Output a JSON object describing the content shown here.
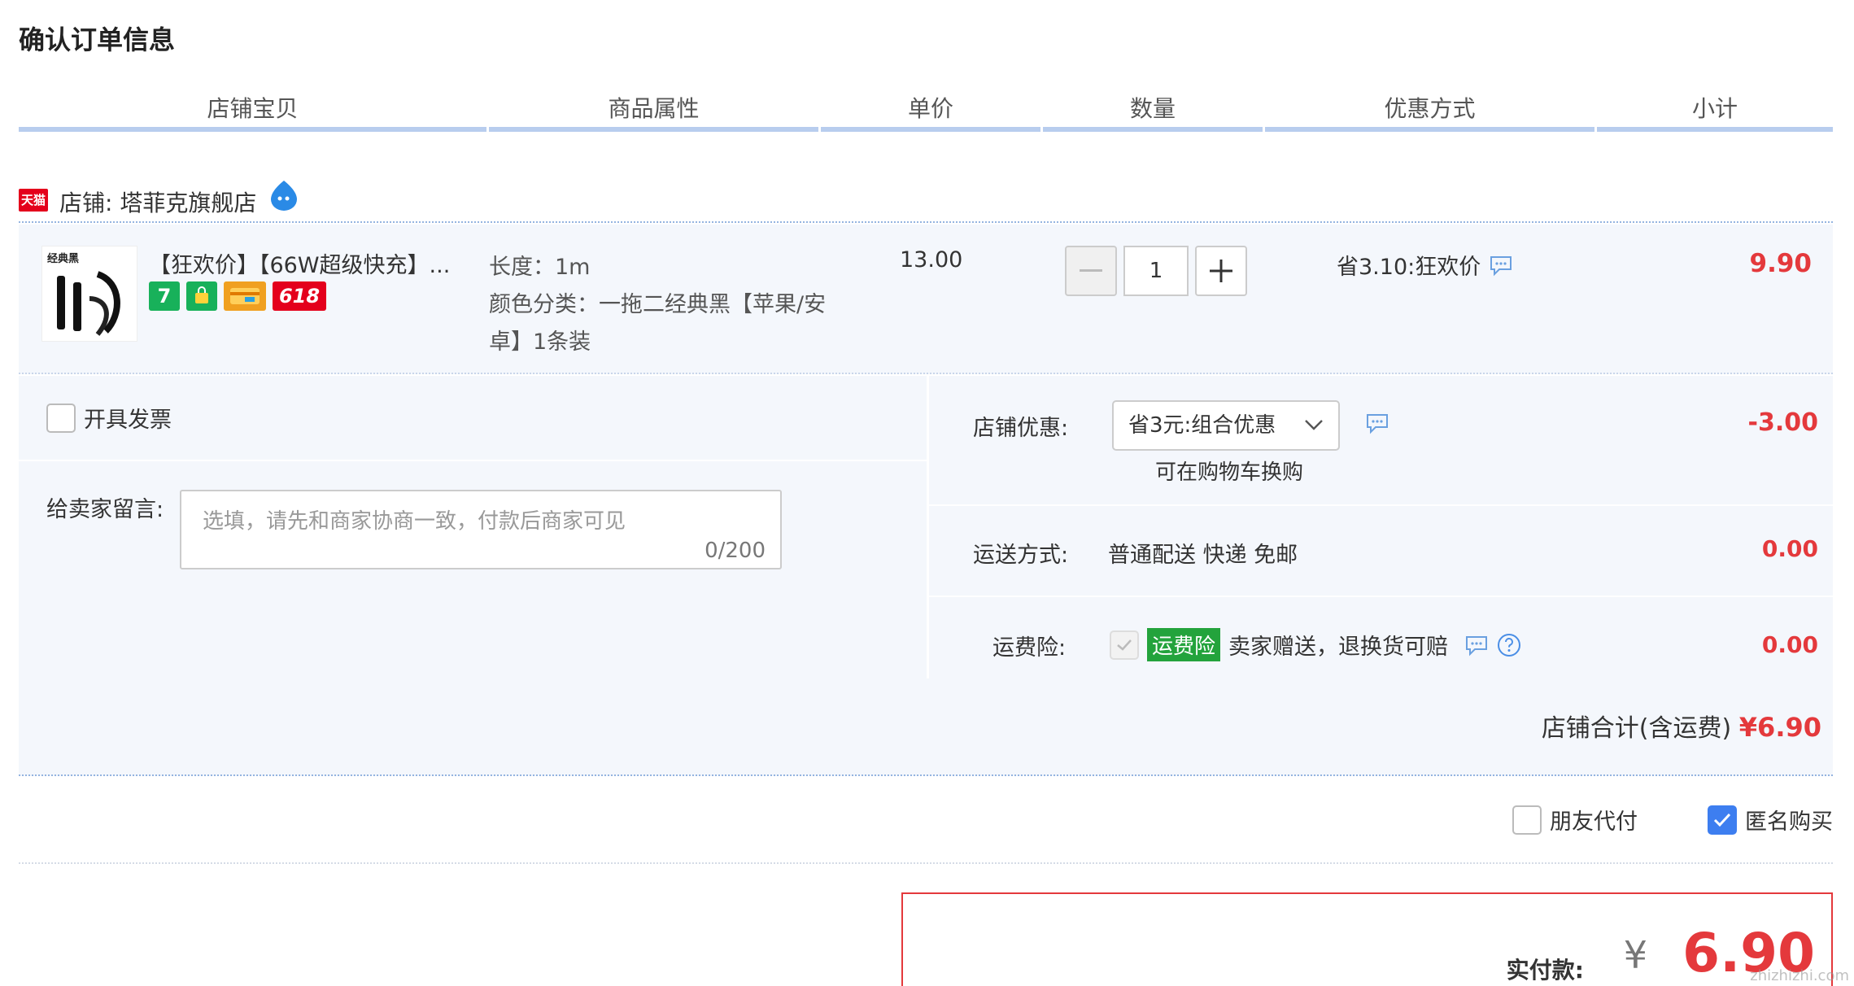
{
  "page": {
    "title": "确认订单信息"
  },
  "columns": [
    "店铺宝贝",
    "商品属性",
    "单价",
    "数量",
    "优惠方式",
    "小计"
  ],
  "shop": {
    "badge": "天猫",
    "label": "店铺: 塔菲克旗舰店"
  },
  "item": {
    "thumb_caption": "经典黑",
    "title": "【狂欢价】【66W超级快充】...",
    "badges": [
      "7",
      "618"
    ],
    "props": [
      "长度：1m",
      "颜色分类：一拖二经典黑【苹果/安卓】1条装"
    ],
    "unit_price": "13.00",
    "quantity": "1",
    "promo": "省3.10:狂欢价",
    "subtotal": "9.90"
  },
  "invoice": {
    "label": "开具发票"
  },
  "memo": {
    "label": "给卖家留言:",
    "placeholder": "选填，请先和商家协商一致，付款后商家可见",
    "counter": "0/200"
  },
  "shop_discount": {
    "label": "店铺优惠:",
    "selected": "省3元:组合优惠",
    "hint": "可在购物车换购",
    "amount": "-3.00"
  },
  "shipping": {
    "label": "运送方式:",
    "value": "普通配送 快递 免邮",
    "amount": "0.00"
  },
  "insurance": {
    "label": "运费险:",
    "badge": "运费险",
    "text": "卖家赠送，退换货可赔",
    "amount": "0.00"
  },
  "shop_total": {
    "label": "店铺合计(含运费)",
    "amount": "¥6.90"
  },
  "options": {
    "friend_pay": "朋友代付",
    "anonymous": "匿名购买"
  },
  "payment": {
    "label": "实付款:",
    "currency": "¥",
    "amount": "6.90"
  },
  "watermark": "zhizhizhi.com",
  "colors": {
    "accent_red": "#e4393c",
    "header_rule": "#b8cdee",
    "panel_bg": "#f4f7fc",
    "checkbox_blue": "#3d7ef0"
  }
}
